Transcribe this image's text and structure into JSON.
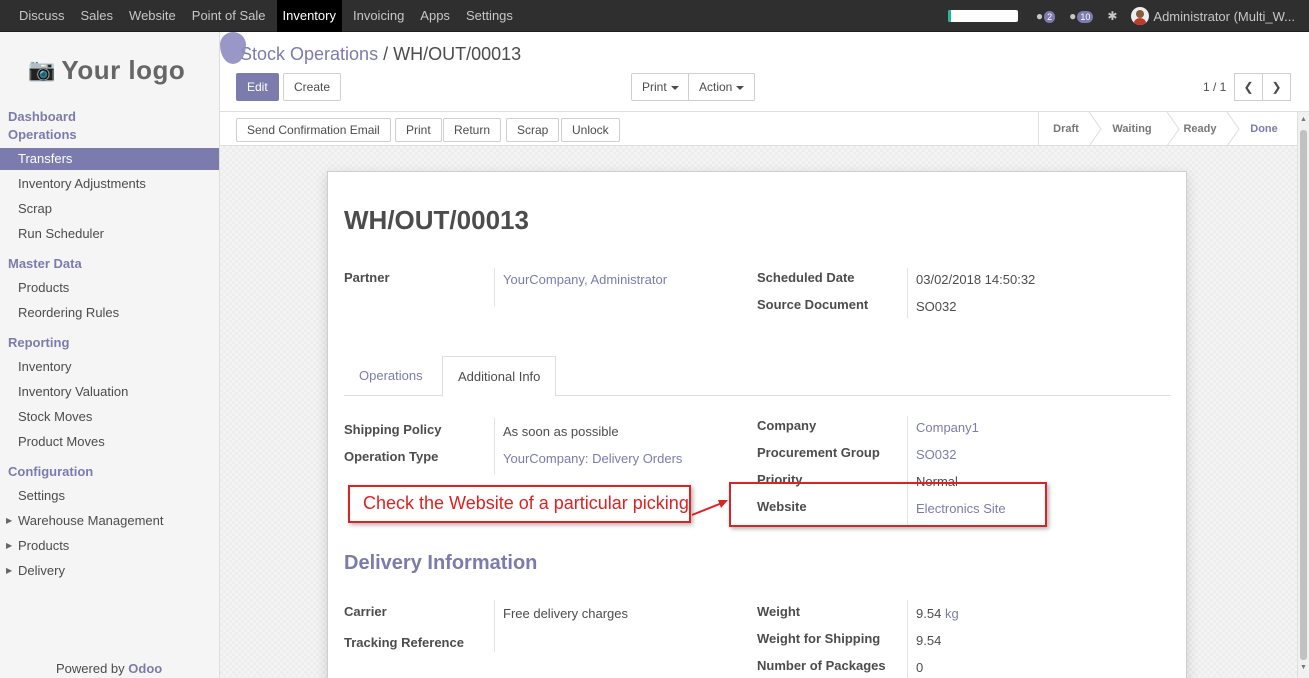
{
  "topbar": {
    "menu": [
      "Discuss",
      "Sales",
      "Website",
      "Point of Sale",
      "Inventory",
      "Invoicing",
      "Apps",
      "Settings"
    ],
    "active_menu": "Inventory",
    "progress_fraction": 0.05,
    "chat_count": "2",
    "messages_count": "10",
    "user": "Administrator (Multi_W..."
  },
  "sidebar": {
    "logo_text": "Your logo",
    "sections": [
      {
        "title": "Dashboard"
      },
      {
        "title": "Operations",
        "items": [
          "Transfers",
          "Inventory Adjustments",
          "Scrap",
          "Run Scheduler"
        ]
      },
      {
        "title": "Master Data",
        "items": [
          "Products",
          "Reordering Rules"
        ]
      },
      {
        "title": "Reporting",
        "items": [
          "Inventory",
          "Inventory Valuation",
          "Stock Moves",
          "Product Moves"
        ]
      },
      {
        "title": "Configuration",
        "items": [
          "Settings",
          "Warehouse Management",
          "Products",
          "Delivery"
        ]
      }
    ],
    "active_item": "Transfers",
    "powered_by": "Powered by",
    "powered_brand": "Odoo"
  },
  "control": {
    "breadcrumb_parent": "Stock Operations",
    "breadcrumb_sep": "/",
    "breadcrumb_current": "WH/OUT/00013",
    "edit_label": "Edit",
    "create_label": "Create",
    "print_label": "Print",
    "action_label": "Action",
    "pager": "1 / 1"
  },
  "statusbar": {
    "buttons": [
      "Send Confirmation Email",
      "Print",
      "Return",
      "Scrap",
      "Unlock"
    ],
    "stages": [
      "Draft",
      "Waiting",
      "Ready",
      "Done"
    ],
    "current_stage": "Done"
  },
  "form": {
    "title": "WH/OUT/00013",
    "partner_label": "Partner",
    "partner_value": "YourCompany, Administrator",
    "scheduled_label": "Scheduled Date",
    "scheduled_value": "03/02/2018 14:50:32",
    "source_label": "Source Document",
    "source_value": "SO032",
    "tabs": [
      "Operations",
      "Additional Info"
    ],
    "active_tab": "Additional Info",
    "shipping_policy_label": "Shipping Policy",
    "shipping_policy_value": "As soon as possible",
    "operation_type_label": "Operation Type",
    "operation_type_value": "YourCompany: Delivery Orders",
    "company_label": "Company",
    "company_value": "Company1",
    "procurement_label": "Procurement Group",
    "procurement_value": "SO032",
    "priority_label": "Priority",
    "priority_value": "Normal",
    "website_label": "Website",
    "website_value": "Electronics Site",
    "delivery_title": "Delivery Information",
    "carrier_label": "Carrier",
    "carrier_value": "Free delivery charges",
    "tracking_label": "Tracking Reference",
    "weight_label": "Weight",
    "weight_value": "9.54",
    "weight_unit": "kg",
    "weight_shipping_label": "Weight for Shipping",
    "weight_shipping_value": "9.54",
    "packages_label": "Number of Packages",
    "packages_value": "0"
  },
  "annotation": {
    "text": "Check the Website of a particular picking"
  }
}
